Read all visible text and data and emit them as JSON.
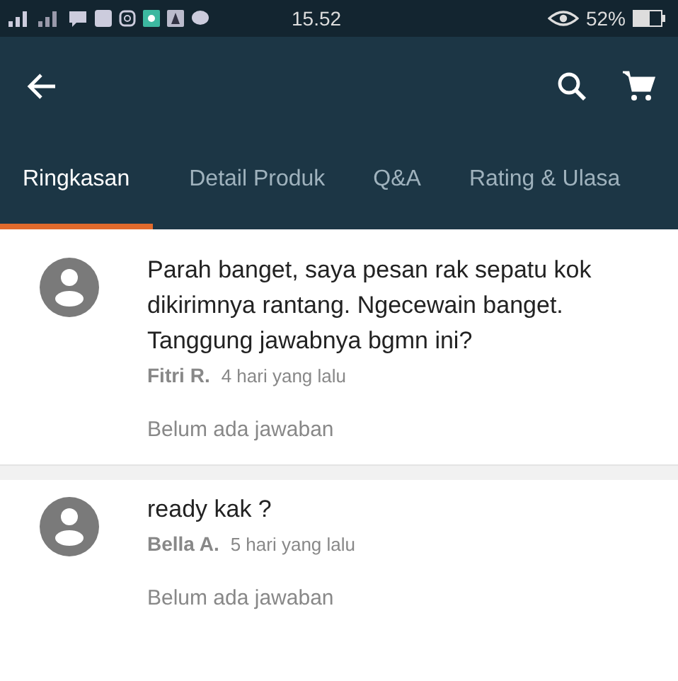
{
  "status_bar": {
    "time": "15.52",
    "battery": "52%"
  },
  "tabs": [
    {
      "label": "Ringkasan",
      "selected": true
    },
    {
      "label": "Detail Produk",
      "selected": false
    },
    {
      "label": "Q&A",
      "selected": false
    },
    {
      "label": "Rating & Ulasa",
      "selected": false
    }
  ],
  "questions": [
    {
      "text": "Parah banget, saya pesan rak sepatu kok dikirimnya rantang. Ngecewain banget. Tanggung jawabnya bgmn ini?",
      "author": "Fitri R.",
      "time": "4 hari yang lalu",
      "answer": "Belum ada jawaban"
    },
    {
      "text": "ready kak ?",
      "author": "Bella A.",
      "time": "5 hari yang lalu",
      "answer": "Belum ada jawaban"
    }
  ]
}
